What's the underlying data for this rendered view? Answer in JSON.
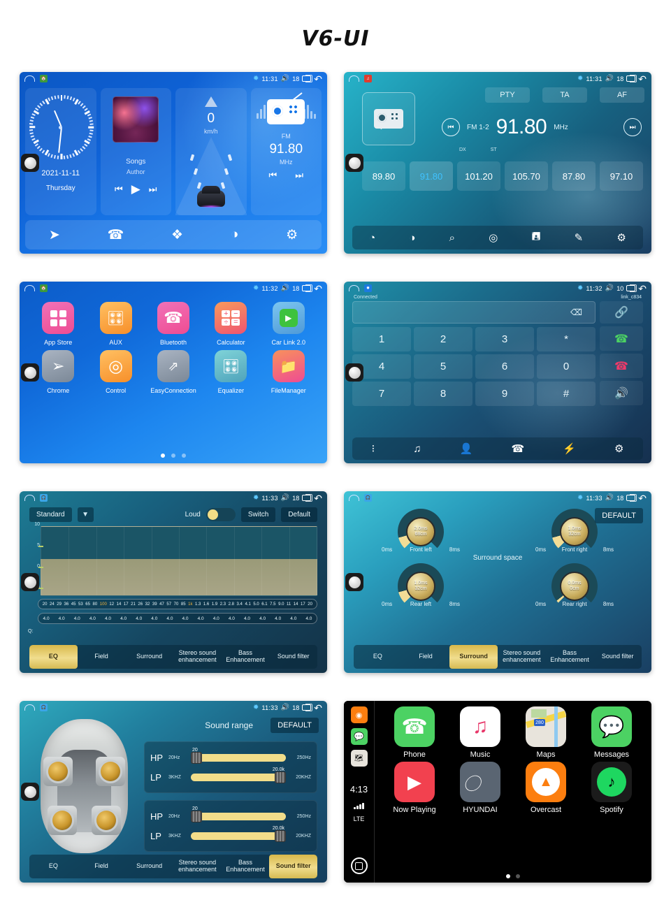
{
  "title": "V6-UI",
  "statusbar_common": {
    "bluetooth_icon": "bluetooth-icon",
    "volume_icon": "volume-icon",
    "recents_icon": "recents-icon",
    "back_icon": "back-icon",
    "home_icon": "home-outline-icon"
  },
  "screens": {
    "home": {
      "name": "home-screen",
      "status": {
        "time": "11:31",
        "volume": "18"
      },
      "clock_widget": {
        "date": "2021-11-11",
        "weekday": "Thursday"
      },
      "music_widget": {
        "title": "Songs",
        "artist": "Author",
        "prev_icon": "previous-track-icon",
        "play_icon": "play-icon",
        "next_icon": "next-track-icon"
      },
      "nav_widget": {
        "speed": "0",
        "unit": "km/h",
        "arrow_icon": "navigation-arrow-icon"
      },
      "radio_widget": {
        "band": "FM",
        "frequency": "91.80",
        "unit": "MHz",
        "prev_icon": "previous-station-icon",
        "next_icon": "next-station-icon"
      },
      "dock": [
        {
          "name": "navigation-icon",
          "glyph": "➤"
        },
        {
          "name": "phone-icon",
          "glyph": "✆"
        },
        {
          "name": "apps-icon",
          "glyph": "❖"
        },
        {
          "name": "car-link-icon",
          "glyph": "◖"
        },
        {
          "name": "settings-icon",
          "glyph": "⚙"
        }
      ]
    },
    "radio": {
      "name": "radio-screen",
      "status": {
        "time": "11:31",
        "volume": "18"
      },
      "rds_buttons": [
        "PTY",
        "TA",
        "AF"
      ],
      "band": "FM 1-2",
      "frequency": "91.80",
      "unit": "MHz",
      "tuner_labels": [
        "DX",
        "ST"
      ],
      "presets": [
        "89.80",
        "91.80",
        "101.20",
        "105.70",
        "87.80",
        "97.10"
      ],
      "active_preset_index": 1,
      "dock": [
        {
          "name": "band-icon",
          "glyph": "◔"
        },
        {
          "name": "stereo-mono-icon",
          "glyph": "◑"
        },
        {
          "name": "search-icon",
          "glyph": "⌕"
        },
        {
          "name": "location-rds-icon",
          "glyph": "◎"
        },
        {
          "name": "save-icon",
          "glyph": "Ὃe"
        },
        {
          "name": "edit-icon",
          "glyph": "✎"
        },
        {
          "name": "settings-icon",
          "glyph": "⚙"
        }
      ]
    },
    "apps": {
      "name": "apps-screen",
      "status": {
        "time": "11:32",
        "volume": "18"
      },
      "items": [
        {
          "label": "App Store",
          "icon": "app-store-icon",
          "color": "#f0569b",
          "glyph": ""
        },
        {
          "label": "AUX",
          "icon": "aux-icon",
          "color": "#f7a03a",
          "glyph": "🎚"
        },
        {
          "label": "Bluetooth",
          "icon": "bluetooth-app-icon",
          "color": "#f0569b",
          "glyph": "✆"
        },
        {
          "label": "Calculator",
          "icon": "calculator-icon",
          "color": "#f2674e",
          "glyph": "⊞"
        },
        {
          "label": "Car Link 2.0",
          "icon": "car-link-icon",
          "color": "#5bb0e8",
          "glyph": "▶"
        },
        {
          "label": "Chrome",
          "icon": "chrome-icon",
          "color": "#8b95a5",
          "glyph": "✆"
        },
        {
          "label": "Control",
          "icon": "steering-wheel-icon",
          "color": "#f7a03a",
          "glyph": "◎"
        },
        {
          "label": "EasyConnection",
          "icon": "easy-connection-icon",
          "color": "#8b95a5",
          "glyph": "↗"
        },
        {
          "label": "Equalizer",
          "icon": "equalizer-icon",
          "color": "#64b6c4",
          "glyph": "🎚"
        },
        {
          "label": "FileManager",
          "icon": "file-manager-icon",
          "color": "#f0569b",
          "glyph": "📁"
        }
      ],
      "page_dots": 3,
      "active_dot": 0
    },
    "phone": {
      "name": "bluetooth-dialer-screen",
      "status": {
        "time": "11:32",
        "volume": "10"
      },
      "connection_status": "Connected",
      "device_name": "link_c834",
      "number_value": "",
      "backspace_icon": "backspace-icon",
      "keys": [
        "1",
        "2",
        "3",
        "*",
        "4",
        "5",
        "6",
        "0",
        "7",
        "8",
        "9",
        "#"
      ],
      "side_buttons": [
        {
          "name": "link-icon",
          "glyph": "🔗"
        },
        {
          "name": "call-answer-icon",
          "glyph": "✆"
        },
        {
          "name": "call-end-icon",
          "glyph": "✆"
        },
        {
          "name": "speaker-icon",
          "glyph": "🔊"
        }
      ],
      "dock": [
        {
          "name": "dialpad-icon",
          "glyph": "⁙"
        },
        {
          "name": "music-icon",
          "glyph": "♫"
        },
        {
          "name": "contacts-icon",
          "glyph": "☰"
        },
        {
          "name": "call-log-icon",
          "glyph": "✆"
        },
        {
          "name": "bluetooth-pair-icon",
          "glyph": "⚡"
        },
        {
          "name": "settings-icon",
          "glyph": "⚙"
        }
      ]
    },
    "equalizer": {
      "name": "equalizer-screen",
      "status": {
        "time": "11:33",
        "volume": "18"
      },
      "preset": "Standard",
      "dropdown_icon": "chevron-down-icon",
      "loud_label": "Loud",
      "loud_on": true,
      "switch_label": "Switch",
      "default_label": "Default",
      "y_axis": [
        "10",
        "5",
        "0",
        "-5"
      ],
      "q_label": "Q:",
      "frequencies": [
        "20",
        "24",
        "29",
        "36",
        "45",
        "53",
        "65",
        "80",
        "100",
        "12",
        "14",
        "17",
        "21",
        "26",
        "32",
        "39",
        "47",
        "57",
        "70",
        "85",
        "1k",
        "1.3",
        "1.6",
        "1.9",
        "2.3",
        "2.8",
        "3.4",
        "4.1",
        "5.0",
        "6.1",
        "7.5",
        "9.0",
        "11",
        "14",
        "17",
        "20"
      ],
      "highlight_frequencies": [
        "100",
        "1k"
      ],
      "q_values": [
        "4.0",
        "4.0",
        "4.0",
        "4.0",
        "4.0",
        "4.0",
        "4.0",
        "4.0",
        "4.0",
        "4.0",
        "4.0",
        "4.0",
        "4.0",
        "4.0",
        "4.0",
        "4.0",
        "4.0",
        "4.0"
      ],
      "tabs": [
        "EQ",
        "Field",
        "Surround",
        "Stereo sound enhancement",
        "Bass Enhancement",
        "Sound filter"
      ],
      "active_tab": "EQ"
    },
    "surround": {
      "name": "surround-screen",
      "status": {
        "time": "11:33",
        "volume": "18"
      },
      "default_label": "DEFAULT",
      "section_label": "Surround space",
      "knobs": [
        {
          "label": "Front left",
          "delay": "2.0ms",
          "distance": "68cm",
          "min": "0ms",
          "max": "8ms"
        },
        {
          "label": "Front right",
          "delay": "1.0ms",
          "distance": "32cm",
          "min": "0ms",
          "max": "8ms"
        },
        {
          "label": "Rear left",
          "delay": "1.0ms",
          "distance": "32cm",
          "min": "0ms",
          "max": "8ms"
        },
        {
          "label": "Rear right",
          "delay": "0.0ms",
          "distance": "0cm",
          "min": "0ms",
          "max": "8ms"
        }
      ],
      "tabs": [
        "EQ",
        "Field",
        "Surround",
        "Stereo sound enhancement",
        "Bass Enhancement",
        "Sound filter"
      ],
      "active_tab": "Surround"
    },
    "sound_filter": {
      "name": "sound-filter-screen",
      "status": {
        "time": "11:33",
        "volume": "18"
      },
      "title": "Sound range",
      "default_label": "DEFAULT",
      "filters": [
        {
          "tag": "HP",
          "min": "20Hz",
          "max": "250Hz",
          "value": "20"
        },
        {
          "tag": "LP",
          "min": "3KHZ",
          "max": "20KHZ",
          "value": "20.0k"
        },
        {
          "tag": "HP",
          "min": "20Hz",
          "max": "250Hz",
          "value": "20"
        },
        {
          "tag": "LP",
          "min": "3KHZ",
          "max": "20KHZ",
          "value": "20.0k"
        }
      ],
      "car_icon": "car-speakers-diagram",
      "tabs": [
        "EQ",
        "Field",
        "Surround",
        "Stereo sound enhancement",
        "Bass Enhancement",
        "Sound filter"
      ],
      "active_tab": "Sound filter"
    },
    "carplay": {
      "name": "carplay-screen",
      "sidebar": {
        "time": "4:13",
        "carrier": "LTE",
        "signal_icon": "signal-bars-icon",
        "home_icon": "carplay-home-icon",
        "mini_icons": [
          "overcast-mini-icon",
          "messages-mini-icon",
          "maps-mini-icon"
        ]
      },
      "apps": [
        {
          "label": "Phone",
          "icon": "phone-icon",
          "color": "#4cd263"
        },
        {
          "label": "Music",
          "icon": "music-icon",
          "color": "#ffffff"
        },
        {
          "label": "Maps",
          "icon": "maps-icon",
          "color": "#e8e4dc"
        },
        {
          "label": "Messages",
          "icon": "messages-icon",
          "color": "#4cd263"
        },
        {
          "label": "Now Playing",
          "icon": "now-playing-icon",
          "color": "#f2414f"
        },
        {
          "label": "HYUNDAI",
          "icon": "hyundai-icon",
          "color": "#5a6572"
        },
        {
          "label": "Overcast",
          "icon": "overcast-icon",
          "color": "#fc7e0f"
        },
        {
          "label": "Spotify",
          "icon": "spotify-icon",
          "color": "#1b1b1b"
        }
      ],
      "page_dots": 2,
      "active_dot": 0
    }
  }
}
